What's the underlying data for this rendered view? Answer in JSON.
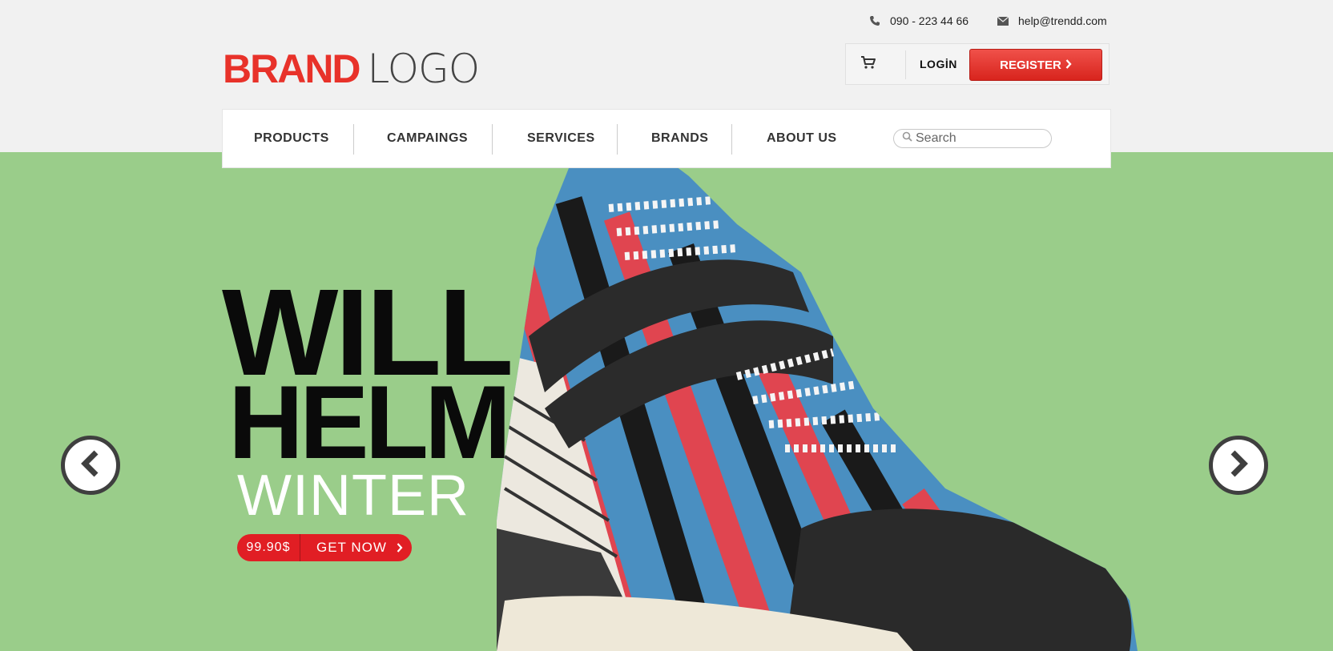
{
  "contact": {
    "phone": "090 - 223 44 66",
    "email": "help@trendd.com"
  },
  "logo": {
    "part1": "BRAND",
    "part2": "LOGO"
  },
  "account": {
    "login_label": "LOGİN",
    "register_label": "REGISTER"
  },
  "nav": {
    "items": [
      {
        "label": "PRODUCTS"
      },
      {
        "label": "CAMPAINGS"
      },
      {
        "label": "SERVICES"
      },
      {
        "label": "BRANDS"
      },
      {
        "label": "ABOUT US"
      }
    ],
    "search_placeholder": "Search"
  },
  "hero": {
    "line1": "WILL",
    "line2": "HELM",
    "line3": "WINTER",
    "price": "99.90$",
    "cta": "GET NOW"
  },
  "colors": {
    "accent": "#e8322a",
    "hero_bg": "#9acd8a",
    "cta": "#e11e24"
  },
  "icons": [
    "phone-icon",
    "mail-icon",
    "cart-icon",
    "search-icon",
    "chevron-left-icon",
    "chevron-right-icon"
  ]
}
